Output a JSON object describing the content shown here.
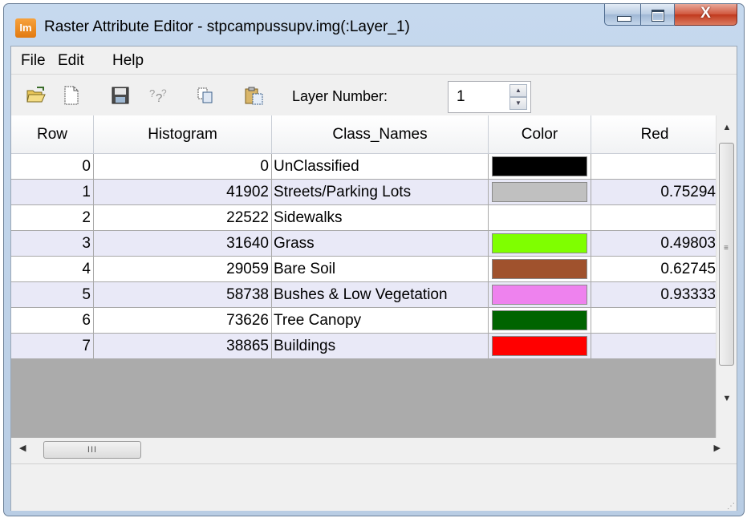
{
  "window": {
    "app_icon_text": "Im",
    "title": "Raster Attribute Editor - stpcampussupv.img(:Layer_1)",
    "close_glyph": "X"
  },
  "menu": {
    "file": "File",
    "edit": "Edit",
    "help": "Help"
  },
  "toolbar": {
    "icons": [
      "open-folder-icon",
      "new-file-icon",
      "save-icon",
      "help-icon",
      "copy-icon",
      "paste-icon"
    ],
    "layer_number_label": "Layer Number:",
    "layer_number_value": "1"
  },
  "table": {
    "columns": [
      "Row",
      "Histogram",
      "Class_Names",
      "Color",
      "Red"
    ],
    "rows": [
      {
        "row": "0",
        "histogram": "0",
        "class_name": "UnClassified",
        "color": "#000000",
        "red": ""
      },
      {
        "row": "1",
        "histogram": "41902",
        "class_name": "Streets/Parking Lots",
        "color": "#c0c0c0",
        "red": "0.75294"
      },
      {
        "row": "2",
        "histogram": "22522",
        "class_name": "Sidewalks",
        "color": "#ffffff",
        "red": ""
      },
      {
        "row": "3",
        "histogram": "31640",
        "class_name": "Grass",
        "color": "#7fff00",
        "red": "0.49803"
      },
      {
        "row": "4",
        "histogram": "29059",
        "class_name": "Bare Soil",
        "color": "#a0522d",
        "red": "0.62745"
      },
      {
        "row": "5",
        "histogram": "58738",
        "class_name": "Bushes & Low Vegetation",
        "color": "#ee82ee",
        "red": "0.93333"
      },
      {
        "row": "6",
        "histogram": "73626",
        "class_name": "Tree Canopy",
        "color": "#006400",
        "red": ""
      },
      {
        "row": "7",
        "histogram": "38865",
        "class_name": "Buildings",
        "color": "#ff0000",
        "red": ""
      }
    ]
  },
  "scrollbars": {
    "hthumb_grip": "III"
  }
}
